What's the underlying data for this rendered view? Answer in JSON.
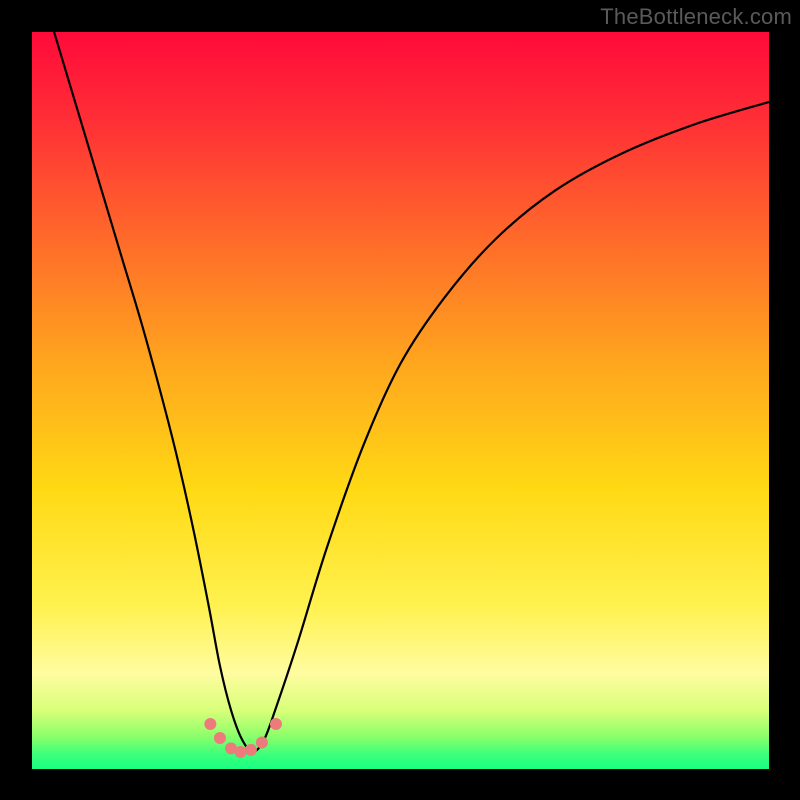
{
  "watermark": "TheBottleneck.com",
  "chart_data": {
    "type": "line",
    "title": "",
    "xlabel": "",
    "ylabel": "",
    "xlim": [
      0,
      100
    ],
    "ylim": [
      0,
      100
    ],
    "background_gradient": {
      "stops": [
        {
          "pos": 0.0,
          "color": "#ff0a3a"
        },
        {
          "pos": 0.12,
          "color": "#ff2f36"
        },
        {
          "pos": 0.28,
          "color": "#ff6a2a"
        },
        {
          "pos": 0.45,
          "color": "#ffa61e"
        },
        {
          "pos": 0.62,
          "color": "#ffd914"
        },
        {
          "pos": 0.78,
          "color": "#fff250"
        },
        {
          "pos": 0.87,
          "color": "#fffca0"
        },
        {
          "pos": 0.92,
          "color": "#d9ff7a"
        },
        {
          "pos": 0.955,
          "color": "#8dff6a"
        },
        {
          "pos": 0.98,
          "color": "#3dff7a"
        },
        {
          "pos": 1.0,
          "color": "#17ff83"
        }
      ]
    },
    "series": [
      {
        "name": "bottleneck-curve",
        "color": "#000000",
        "x": [
          3,
          6,
          9,
          12,
          15,
          18,
          20,
          22,
          24,
          25.5,
          27,
          28.5,
          30,
          31.5,
          33,
          36,
          40,
          45,
          50,
          56,
          63,
          71,
          80,
          90,
          100
        ],
        "y": [
          100,
          90,
          80,
          70,
          60,
          49,
          41,
          32,
          22,
          14,
          8,
          4,
          2.3,
          4,
          8,
          17,
          30,
          44,
          55,
          64,
          72,
          78.5,
          83.5,
          87.5,
          90.5
        ]
      }
    ],
    "markers": {
      "name": "valley-markers",
      "color": "#ee7b7b",
      "radius_px": 6,
      "x": [
        24.2,
        25.5,
        27,
        28.3,
        29.7,
        31.2,
        33.1
      ],
      "y": [
        6.1,
        4.2,
        2.8,
        2.3,
        2.6,
        3.6,
        6.1
      ]
    }
  }
}
